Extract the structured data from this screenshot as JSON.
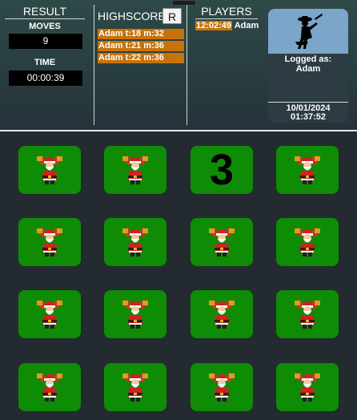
{
  "result": {
    "title": "RESULT",
    "moves_label": "MOVES",
    "moves_value": "9",
    "time_label": "TIME",
    "time_value": "00:00:39"
  },
  "highscore": {
    "title": "HIGHSCORE",
    "reset_label": "R",
    "entries": [
      "Adam  t:18 m:32",
      "Adam  t:21 m:36",
      "Adam  t:22 m:36"
    ]
  },
  "players": {
    "title": "PLAYERS",
    "entries": [
      {
        "time": "12:02:49",
        "name": "Adam"
      }
    ]
  },
  "login": {
    "logged_as_label": "Logged as:",
    "user": "Adam",
    "date": "10/01/2024",
    "time": "01:37:52"
  },
  "board": {
    "revealed_card_number": "3",
    "card_icon": "santa-icon",
    "colors": {
      "card": "#0e8c05",
      "background": "#232a30",
      "highscore": "#c8730a",
      "avatar": "#7ba5c9"
    }
  }
}
